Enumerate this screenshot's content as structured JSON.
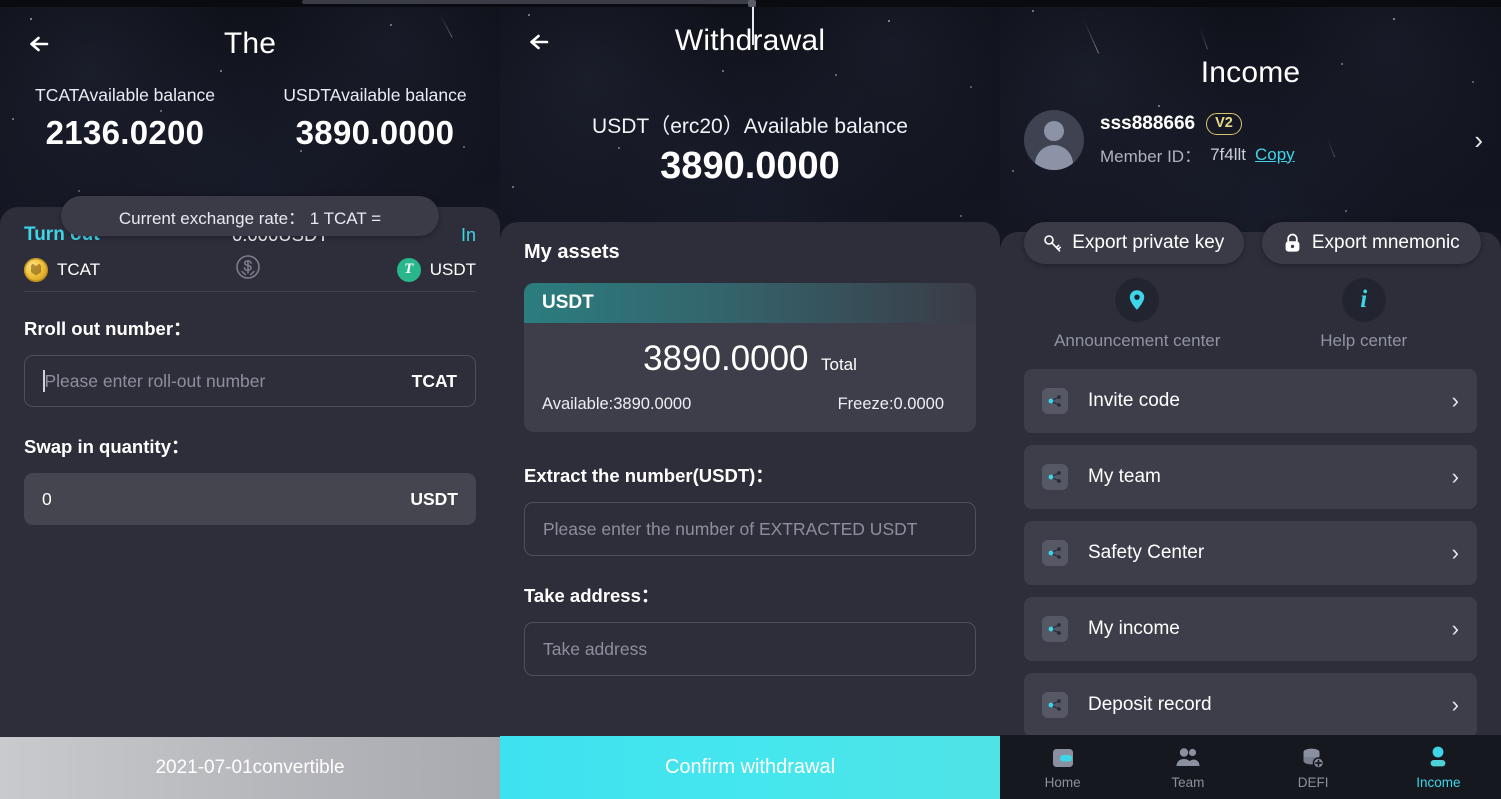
{
  "app": {
    "accent_cyan": "#3fd5e8",
    "card_bg": "#2e2e3a",
    "sky_bg": "#11131d",
    "gold": "#e5d887"
  },
  "panel_swap": {
    "title": "The",
    "back_icon": "back-arrow-icon",
    "balances": [
      {
        "label": "TCATAvailable balance",
        "value": "2136.0200"
      },
      {
        "label": "USDTAvailable balance",
        "value": "3890.0000"
      }
    ],
    "exchange_rate": "Current exchange rate： 1 TCAT =",
    "swap": {
      "turn_out_label": "Turn out",
      "mid_amount": "0.000USDT",
      "in_label": "In",
      "from_token": "TCAT",
      "to_token": "USDT",
      "swap_icon": "swap-circle-icon"
    },
    "roll_out": {
      "label": "Rroll out number：",
      "placeholder": "Please enter roll-out number",
      "suffix": "TCAT"
    },
    "swap_in": {
      "label": "Swap in quantity：",
      "value": "0",
      "suffix": "USDT"
    },
    "chart_icon": "candlestick-chart-icon",
    "bottom_bar": "2021-07-01convertible"
  },
  "panel_withdrawal": {
    "title": "Withdrawal",
    "back_icon": "back-arrow-icon",
    "balance_label": "USDT（erc20）Available balance",
    "balance_value": "3890.0000",
    "my_assets_title": "My assets",
    "asset": {
      "symbol": "USDT",
      "total_value": "3890.0000",
      "total_label": "Total",
      "available": "Available:3890.0000",
      "freeze": "Freeze:0.0000"
    },
    "extract": {
      "label": "Extract the number(USDT)：",
      "placeholder": "Please enter the number of EXTRACTED USDT"
    },
    "address": {
      "label": "Take address：",
      "placeholder": "Take address"
    },
    "confirm_button": "Confirm withdrawal"
  },
  "panel_income": {
    "title": "Income",
    "profile": {
      "avatar_icon": "user-avatar-icon",
      "name": "sss888666",
      "level_badge": "V2",
      "member_id_label": "Member ID：",
      "member_id_value": "7f4llt",
      "copy_label": "Copy",
      "chevron_icon": "chevron-right-icon"
    },
    "export_buttons": [
      {
        "label": "Export private key",
        "icon": "key-icon"
      },
      {
        "label": "Export mnemonic",
        "icon": "lock-icon"
      }
    ],
    "centers": [
      {
        "label": "Announcement center",
        "icon": "location-pin-icon"
      },
      {
        "label": "Help center",
        "icon": "info-icon"
      }
    ],
    "menu": [
      {
        "label": "Invite code",
        "icon": "share-nodes-icon"
      },
      {
        "label": "My team",
        "icon": "share-nodes-icon"
      },
      {
        "label": "Safety Center",
        "icon": "share-nodes-icon"
      },
      {
        "label": "My income",
        "icon": "share-nodes-icon"
      },
      {
        "label": "Deposit record",
        "icon": "share-nodes-icon"
      }
    ],
    "tabs": [
      {
        "label": "Home",
        "icon": "wallet-icon",
        "active": false
      },
      {
        "label": "Team",
        "icon": "people-icon",
        "active": false
      },
      {
        "label": "DEFI",
        "icon": "coins-plus-icon",
        "active": false
      },
      {
        "label": "Income",
        "icon": "person-icon",
        "active": true
      }
    ]
  }
}
